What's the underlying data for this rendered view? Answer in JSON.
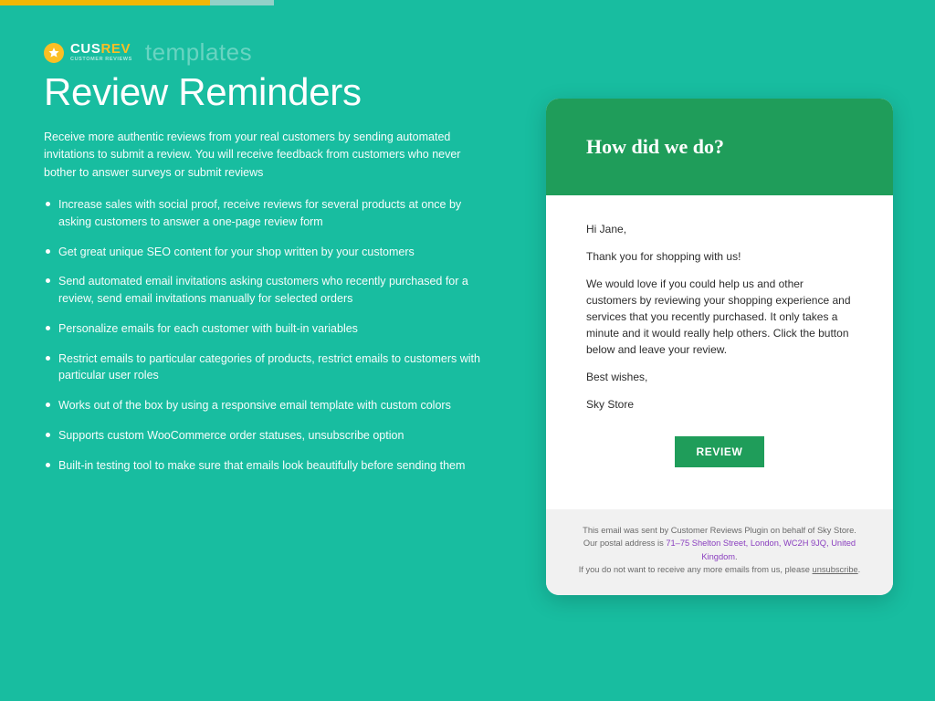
{
  "brand": {
    "logo": {
      "part_a": "CUS",
      "part_b": "REV",
      "subtitle": "CUSTOMER REVIEWS"
    },
    "templates_label": "templates"
  },
  "title": "Review Reminders",
  "intro": "Receive more authentic reviews from your real customers by sending automated invitations to submit a review. You will receive feedback from customers who never bother to answer surveys or submit reviews",
  "features": [
    "Increase sales with social proof, receive reviews for several products at once by asking customers to answer a one-page review form",
    "Get great unique SEO content for your shop written by your customers",
    "Send automated email invitations asking customers who recently purchased for a review, send email invitations manually for selected orders",
    "Personalize emails for each customer with built-in variables",
    "Restrict emails to particular categories of products, restrict emails to customers with particular user roles",
    "Works out of the box by using a responsive email template with custom colors",
    "Supports custom WooCommerce order statuses, unsubscribe option",
    "Built-in testing tool to make sure that emails look beautifully before sending them"
  ],
  "email": {
    "subject": "How did we do?",
    "greeting": "Hi Jane,",
    "line1": "Thank you for shopping with us!",
    "line2": "We would love if you could help us and other customers by reviewing your shopping experience and services that you recently purchased. It only takes a minute and it would really help others. Click the button below and leave your review.",
    "signoff": "Best wishes,",
    "sender": "Sky Store",
    "button": "REVIEW",
    "footer": {
      "line1": "This email was sent by Customer Reviews Plugin on behalf of Sky Store.",
      "line2_prefix": "Our postal address is ",
      "address": "71–75 Shelton Street, London, WC2H 9JQ, United Kingdom",
      "line3_prefix": "If you do not want to receive any more emails from us, please ",
      "unsubscribe": "unsubscribe"
    }
  }
}
